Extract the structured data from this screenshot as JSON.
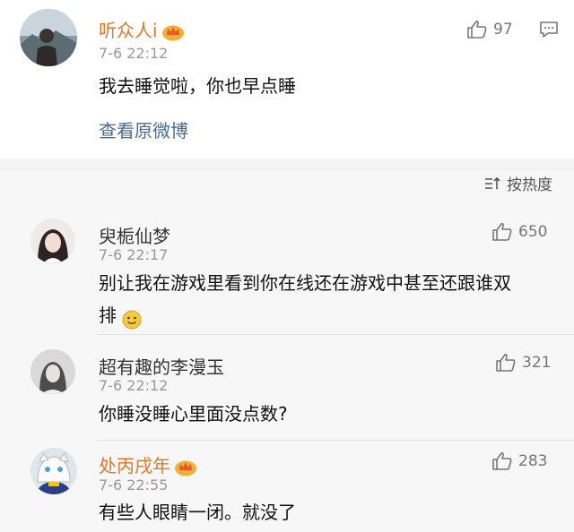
{
  "post": {
    "username": "听众人i",
    "timestamp": "7-6 22:12",
    "likes": "97",
    "text": "我去睡觉啦，你也早点睡",
    "view_original": "查看原微博",
    "icons": {
      "like": "thumbs-up-icon",
      "comment": "comment-icon",
      "vip": "crown-vip-icon"
    }
  },
  "sort": {
    "label": "按热度",
    "icon": "sort-icon"
  },
  "comments": [
    {
      "username": "臾栀仙梦",
      "timestamp": "7-6 22:17",
      "likes": "650",
      "text": "别让我在游戏里看到你在线还在游戏中甚至还跟谁双",
      "text_line2": "排",
      "emoji": "smile-emoji"
    },
    {
      "username": "超有趣的李漫玉",
      "timestamp": "7-6 22:12",
      "likes": "321",
      "text": "你睡没睡心里面没点数?"
    },
    {
      "username": "处丙戌年",
      "timestamp": "7-6 22:55",
      "likes": "283",
      "text": "有些人眼睛一闭。就没了",
      "vip": true
    }
  ],
  "colors": {
    "vip_name": "#e0782b",
    "link": "#4a6b94",
    "muted": "#999999",
    "background": "#f7f7f7"
  }
}
